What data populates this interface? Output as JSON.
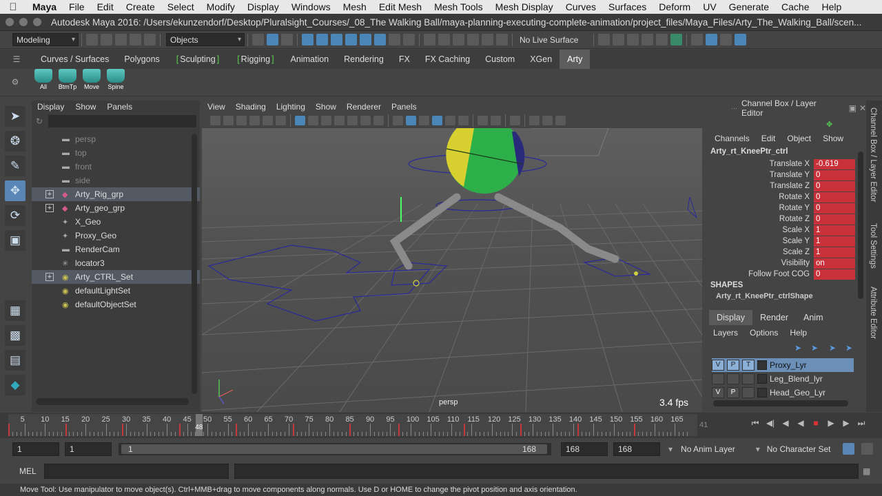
{
  "mac_menu": {
    "app": "Maya",
    "items": [
      "File",
      "Edit",
      "Create",
      "Select",
      "Modify",
      "Display",
      "Windows",
      "Mesh",
      "Edit Mesh",
      "Mesh Tools",
      "Mesh Display",
      "Curves",
      "Surfaces",
      "Deform",
      "UV",
      "Generate",
      "Cache",
      "Help"
    ]
  },
  "window_title": "Autodesk Maya 2016: /Users/ekunzendorf/Desktop/Pluralsight_Courses/_08_The Walking Ball/maya-planning-executing-complete-animation/project_files/Maya_Files/Arty_The_Walking_Ball/scen...",
  "status_line": {
    "mode": "Modeling",
    "selection_mask": "Objects",
    "live_surface": "No Live Surface"
  },
  "shelf_tabs": [
    {
      "label": "Curves / Surfaces",
      "active": false
    },
    {
      "label": "Polygons",
      "active": false
    },
    {
      "label": "Sculpting",
      "active": false,
      "bracket": true
    },
    {
      "label": "Rigging",
      "active": false,
      "bracket": true
    },
    {
      "label": "Animation",
      "active": false
    },
    {
      "label": "Rendering",
      "active": false
    },
    {
      "label": "FX",
      "active": false
    },
    {
      "label": "FX Caching",
      "active": false
    },
    {
      "label": "Custom",
      "active": false
    },
    {
      "label": "XGen",
      "active": false
    },
    {
      "label": "Arty",
      "active": true
    }
  ],
  "shelf_buttons": [
    "All",
    "BtmTp",
    "Move",
    "Spine"
  ],
  "outliner": {
    "menu": [
      "Display",
      "Show",
      "Panels"
    ],
    "items": [
      {
        "label": "persp",
        "icon": "camera-icon",
        "dim": true,
        "expand": false,
        "hl": false
      },
      {
        "label": "top",
        "icon": "camera-icon",
        "dim": true,
        "expand": false,
        "hl": false
      },
      {
        "label": "front",
        "icon": "camera-icon",
        "dim": true,
        "expand": false,
        "hl": false
      },
      {
        "label": "side",
        "icon": "camera-icon",
        "dim": true,
        "expand": false,
        "hl": false
      },
      {
        "label": "Arty_Rig_grp",
        "icon": "group-icon",
        "dim": false,
        "expand": true,
        "hl": true
      },
      {
        "label": "Arty_geo_grp",
        "icon": "group-icon",
        "dim": false,
        "expand": true,
        "hl": false
      },
      {
        "label": "X_Geo",
        "icon": "transform-icon",
        "dim": false,
        "expand": false,
        "hl": false
      },
      {
        "label": "Proxy_Geo",
        "icon": "transform-icon",
        "dim": false,
        "expand": false,
        "hl": false
      },
      {
        "label": "RenderCam",
        "icon": "camera-icon",
        "dim": false,
        "expand": false,
        "hl": false
      },
      {
        "label": "locator3",
        "icon": "locator-icon",
        "dim": false,
        "expand": false,
        "hl": false
      },
      {
        "label": "Arty_CTRL_Set",
        "icon": "set-icon",
        "dim": false,
        "expand": true,
        "hl": true
      },
      {
        "label": "defaultLightSet",
        "icon": "set-icon",
        "dim": false,
        "expand": false,
        "hl": false
      },
      {
        "label": "defaultObjectSet",
        "icon": "set-icon",
        "dim": false,
        "expand": false,
        "hl": false
      }
    ]
  },
  "viewport": {
    "menu": [
      "View",
      "Shading",
      "Lighting",
      "Show",
      "Renderer",
      "Panels"
    ],
    "camera_label": "persp",
    "fps": "3.4 fps"
  },
  "channel_box": {
    "title": "Channel Box / Layer Editor",
    "menu": [
      "Channels",
      "Edit",
      "Object",
      "Show"
    ],
    "object": "Arty_rt_KneePtr_ctrl",
    "channels": [
      {
        "name": "Translate X",
        "value": "-0.619"
      },
      {
        "name": "Translate Y",
        "value": "0"
      },
      {
        "name": "Translate Z",
        "value": "0"
      },
      {
        "name": "Rotate X",
        "value": "0"
      },
      {
        "name": "Rotate Y",
        "value": "0"
      },
      {
        "name": "Rotate Z",
        "value": "0"
      },
      {
        "name": "Scale X",
        "value": "1"
      },
      {
        "name": "Scale Y",
        "value": "1"
      },
      {
        "name": "Scale Z",
        "value": "1"
      },
      {
        "name": "Visibility",
        "value": "on"
      },
      {
        "name": "Follow Foot COG",
        "value": "0"
      }
    ],
    "shapes_header": "SHAPES",
    "shape_name": "Arty_rt_KneePtr_ctrlShape"
  },
  "layer_editor": {
    "tabs": [
      "Display",
      "Render",
      "Anim"
    ],
    "menu": [
      "Layers",
      "Options",
      "Help"
    ],
    "layers": [
      {
        "v": "V",
        "p": "P",
        "t": "T",
        "name": "Proxy_Lyr",
        "hl": true
      },
      {
        "v": "",
        "p": "",
        "t": "",
        "name": "Leg_Blend_lyr",
        "hl": false
      },
      {
        "v": "V",
        "p": "P",
        "t": "",
        "name": "Head_Geo_Lyr",
        "hl": false
      }
    ]
  },
  "side_tabs": [
    "Channel Box / Layer Editor",
    "Tool Settings",
    "Attribute Editor"
  ],
  "time_slider": {
    "labels": [
      "5",
      "10",
      "15",
      "20",
      "25",
      "30",
      "35",
      "40",
      "45",
      "50",
      "55",
      "60",
      "65",
      "70",
      "75",
      "80",
      "85",
      "90",
      "95",
      "100",
      "105",
      "110",
      "115",
      "120",
      "125",
      "130",
      "135",
      "140",
      "145",
      "150",
      "155",
      "160",
      "165"
    ],
    "current_frame_label": "48",
    "end_label": "41",
    "key_frames": [
      1,
      15,
      29,
      43,
      57,
      71,
      85,
      97,
      113,
      127,
      141,
      155
    ]
  },
  "range": {
    "start": "1",
    "playback_start": "1",
    "slider_start": "1",
    "slider_end": "168",
    "playback_end": "168",
    "end": "168",
    "anim_layer": "No Anim Layer",
    "character_set": "No Character Set"
  },
  "command_line": {
    "label": "MEL"
  },
  "help_line": "Move Tool: Use manipulator to move object(s). Ctrl+MMB+drag to move components along normals. Use D or HOME to change the pivot position and axis orientation."
}
